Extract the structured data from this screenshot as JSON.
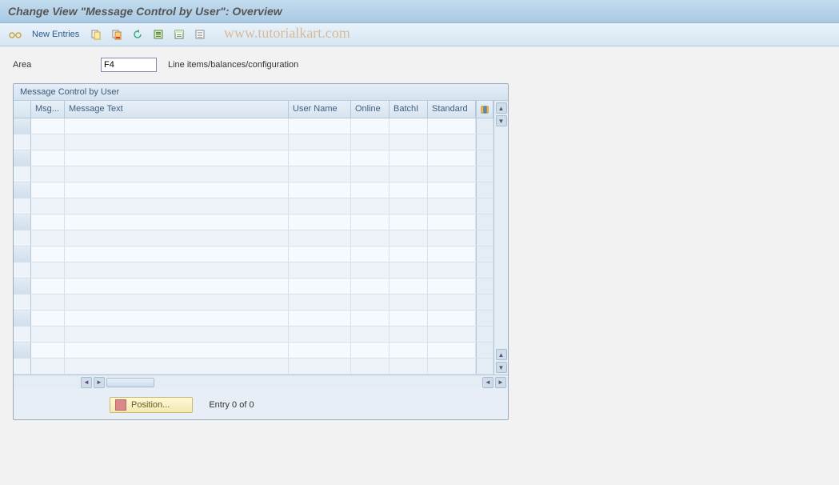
{
  "title": "Change View \"Message Control by User\": Overview",
  "toolbar": {
    "new_entries": "New Entries"
  },
  "watermark": "www.tutorialkart.com",
  "area": {
    "label": "Area",
    "value": "F4",
    "desc": "Line items/balances/configuration"
  },
  "panel": {
    "title": "Message Control by User",
    "columns": {
      "msg": "Msg...",
      "text": "Message Text",
      "user": "User Name",
      "online": "Online",
      "batch": "BatchI",
      "standard": "Standard"
    }
  },
  "footer": {
    "position": "Position...",
    "entry": "Entry 0 of 0"
  }
}
